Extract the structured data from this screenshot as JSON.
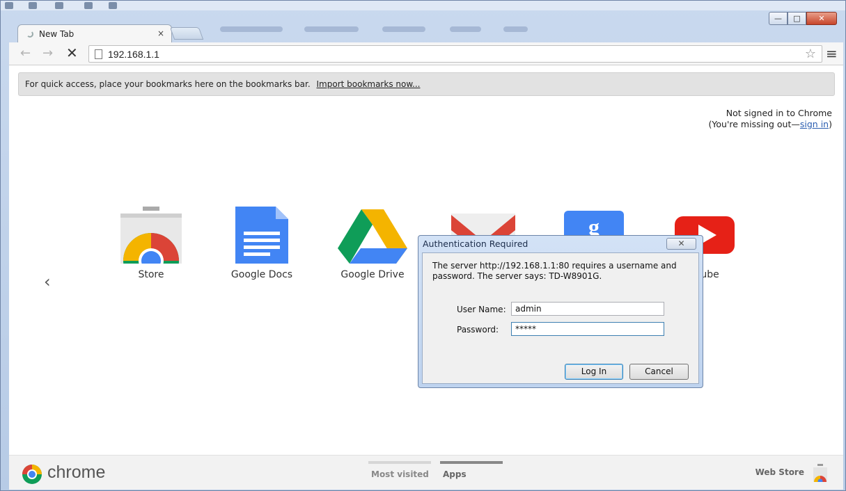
{
  "browser": {
    "tab_title": "New Tab",
    "tab_close": "×",
    "url": "192.168.1.1",
    "stop_glyph": "✕",
    "back_glyph": "←",
    "forward_glyph": "→",
    "star_glyph": "☆",
    "menu_glyph": "≡"
  },
  "window_controls": {
    "minimize": "—",
    "maximize": "□",
    "close": "✕"
  },
  "bookmarks_bar": {
    "text": "For quick access, place your bookmarks here on the bookmarks bar.",
    "link": "Import bookmarks now..."
  },
  "signin": {
    "line1": "Not signed in to Chrome",
    "line2_prefix": "(You're missing out—",
    "link": "sign in",
    "line2_suffix": ")"
  },
  "apps": [
    {
      "label": "Store",
      "icon": "chrome-store-icon"
    },
    {
      "label": "Google Docs",
      "icon": "google-docs-icon"
    },
    {
      "label": "Google Drive",
      "icon": "google-drive-icon"
    },
    {
      "label": "",
      "icon": "gmail-icon"
    },
    {
      "label": "",
      "icon": "google-search-icon"
    },
    {
      "label": "Tube",
      "icon": "youtube-icon"
    }
  ],
  "left_arrow": "‹",
  "footer": {
    "brand": "chrome",
    "tabs": [
      "Most visited",
      "Apps"
    ],
    "web_store": "Web Store"
  },
  "dialog": {
    "title": "Authentication Required",
    "close": "✕",
    "message": "The server http://192.168.1.1:80 requires a username and password. The server says: TD-W8901G.",
    "username_label": "User Name:",
    "username_value": "admin",
    "password_label": "Password:",
    "password_value": "*****",
    "login_button": "Log In",
    "cancel_button": "Cancel"
  },
  "colors": {
    "chrome_red": "#db4437",
    "chrome_green": "#0f9d58",
    "chrome_yellow": "#f4b400",
    "chrome_blue": "#4285f4",
    "docs_blue": "#4285f4",
    "youtube_red": "#e62117",
    "apps_tab_bar": "#888888"
  }
}
